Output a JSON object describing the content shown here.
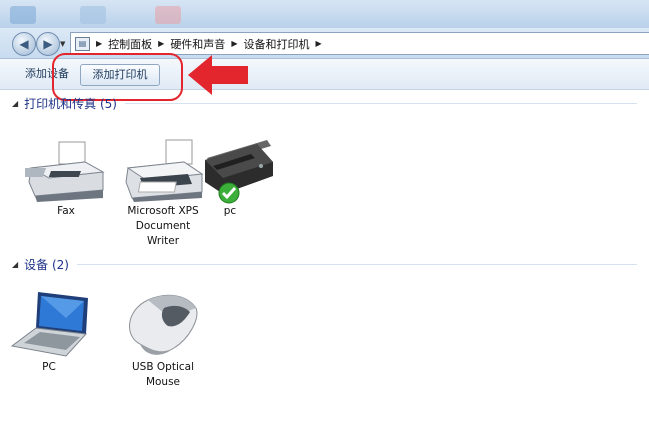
{
  "breadcrumb": {
    "items": [
      "控制面板",
      "硬件和声音",
      "设备和打印机"
    ]
  },
  "toolbar": {
    "add_device": "添加设备",
    "add_printer": "添加打印机"
  },
  "groups": {
    "printers": {
      "title": "打印机和传真 (5)"
    },
    "devices": {
      "title": "设备 (2)"
    }
  },
  "printers": [
    {
      "label": "Fax",
      "icon": "fax-icon"
    },
    {
      "label_lines": [
        "Microsoft XPS",
        "Document",
        "Writer"
      ],
      "icon": "printer-icon"
    },
    {
      "label": "pc",
      "icon": "inkjet-printer-icon",
      "default": true
    }
  ],
  "devices": [
    {
      "label": "PC",
      "icon": "laptop-icon"
    },
    {
      "label_lines": [
        "USB Optical",
        "Mouse"
      ],
      "icon": "mouse-icon"
    }
  ],
  "colors": {
    "annotation": "#e3262d",
    "group_header": "#1e3287"
  }
}
